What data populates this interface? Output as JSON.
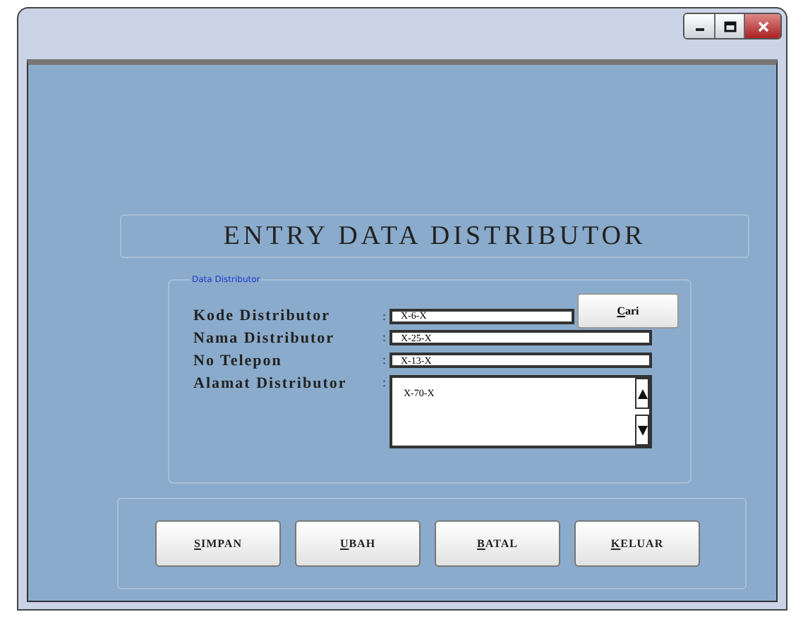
{
  "window": {
    "controls": [
      {
        "kind": "minimize"
      },
      {
        "kind": "maximize"
      },
      {
        "kind": "close"
      }
    ]
  },
  "title": "ENTRY DATA DISTRIBUTOR",
  "group": {
    "legend": "Data Distributor",
    "fields": [
      {
        "label": "Kode Distributor",
        "value": "X-6-X",
        "kind": "short",
        "colon": ":"
      },
      {
        "label": "Nama Distributor",
        "value": "X-25-X",
        "kind": "line",
        "colon": ":"
      },
      {
        "label": "No Telepon",
        "value": "X-13-X",
        "kind": "line",
        "colon": ":"
      },
      {
        "label": "Alamat Distributor",
        "value": "X-70-X",
        "kind": "area",
        "colon": ":"
      }
    ],
    "search_button": "Cari"
  },
  "buttons": [
    "SIMPAN",
    "UBAH",
    "BATAL",
    "KELUAR"
  ]
}
